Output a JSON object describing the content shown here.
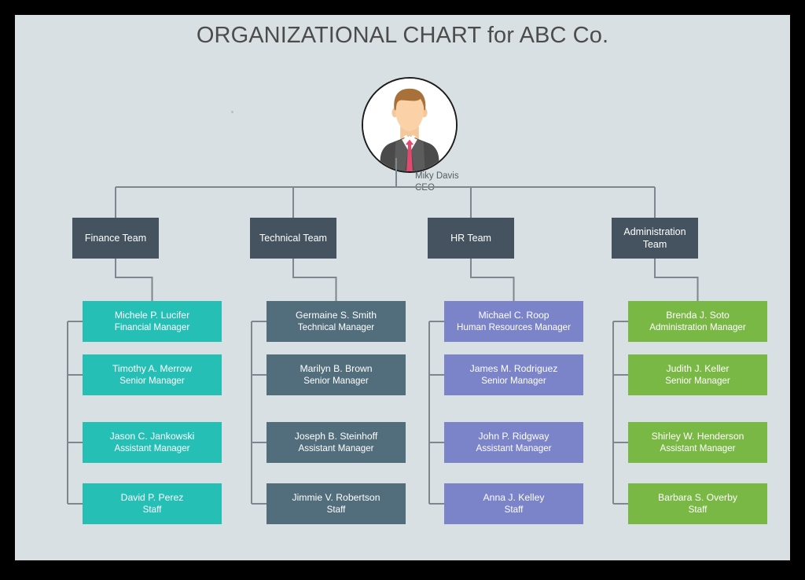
{
  "page": {
    "title": "ORGANIZATIONAL CHART for ABC Co.",
    "background_color": "#d9e0e3",
    "frame_color": "#000000",
    "title_color": "#4c4c4c",
    "connector_color": "#7c888d"
  },
  "ceo": {
    "avatar_icon": "person-avatar-icon",
    "name": "Miky Davis",
    "role": "CEO"
  },
  "departments": [
    {
      "id": "finance",
      "header_label": "Finance Team",
      "header_color": "#44535f",
      "card_color": "#26bfb5",
      "members": [
        {
          "name": "Michele P. Lucifer",
          "role": "Financial Manager"
        },
        {
          "name": "Timothy A. Merrow",
          "role": "Senior Manager"
        },
        {
          "name": "Jason C. Jankowski",
          "role": "Assistant Manager"
        },
        {
          "name": "David P. Perez",
          "role": "Staff"
        }
      ]
    },
    {
      "id": "technical",
      "header_label": "Technical  Team",
      "header_color": "#44535f",
      "card_color": "#526e7d",
      "members": [
        {
          "name": "Germaine S. Smith",
          "role": "Technical  Manager"
        },
        {
          "name": "Marilyn B. Brown",
          "role": "Senior Manager"
        },
        {
          "name": "Joseph B. Steinhoff",
          "role": "Assistant Manager"
        },
        {
          "name": "Jimmie V. Robertson",
          "role": "Staff"
        }
      ]
    },
    {
      "id": "hr",
      "header_label": "HR Team",
      "header_color": "#44535f",
      "card_color": "#7b84c8",
      "members": [
        {
          "name": "Michael C. Roop",
          "role": "Human Resources Manager"
        },
        {
          "name": "James M. Rodriguez",
          "role": "Senior Manager"
        },
        {
          "name": "John P. Ridgway",
          "role": "Assistant Manager"
        },
        {
          "name": "Anna J. Kelley",
          "role": "Staff"
        }
      ]
    },
    {
      "id": "administration",
      "header_label": "Administration Team",
      "header_color": "#44535f",
      "card_color": "#7ab845",
      "members": [
        {
          "name": "Brenda J. Soto",
          "role": "Administration Manager"
        },
        {
          "name": "Judith J. Keller",
          "role": "Senior Manager"
        },
        {
          "name": "Shirley W. Henderson",
          "role": "Assistant Manager"
        },
        {
          "name": "Barbara S. Overby",
          "role": "Staff"
        }
      ]
    }
  ]
}
